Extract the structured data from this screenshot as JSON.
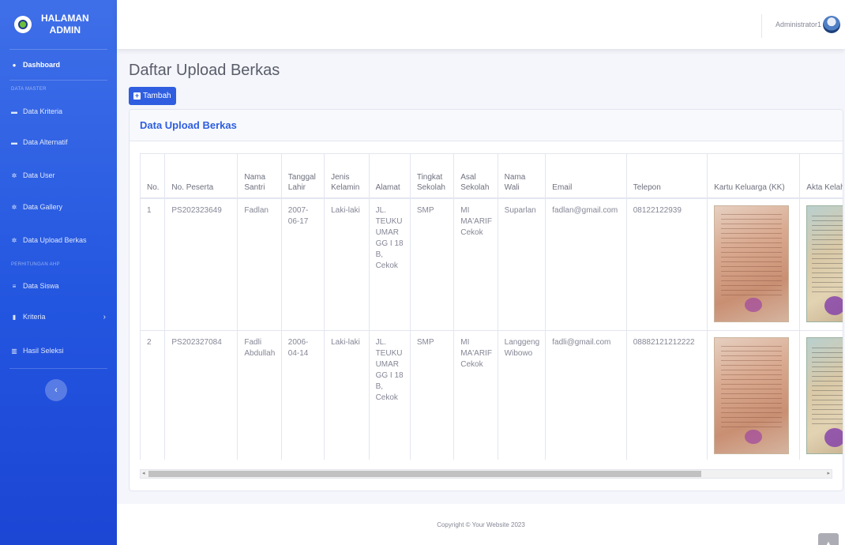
{
  "sidebar": {
    "brand_line1": "HALAMAN",
    "brand_line2": "ADMIN",
    "items": [
      {
        "label": "Dashboard",
        "icon": "tachometer-icon"
      },
      {
        "heading": "DATA MASTER"
      },
      {
        "label": "Data Kriteria",
        "icon": "folder-icon"
      },
      {
        "label": "Data Alternatif",
        "icon": "folder-icon"
      },
      {
        "label": "Data User",
        "icon": "gear-icon"
      },
      {
        "label": "Data Gallery",
        "icon": "gear-icon"
      },
      {
        "label": "Data Upload Berkas",
        "icon": "gear-icon"
      },
      {
        "heading": "PERHITUNGAN AHP"
      },
      {
        "label": "Data Siswa",
        "icon": "list-icon"
      },
      {
        "label": "Kriteria",
        "icon": "document-icon"
      },
      {
        "label": "Hasil Seleksi",
        "icon": "chart-icon"
      }
    ],
    "toggle_icon": "chevron-left-icon"
  },
  "topbar": {
    "user_name": "Administrator1"
  },
  "main": {
    "page_title": "Daftar Upload Berkas",
    "add_button": "Tambah",
    "card_title": "Data Upload Berkas",
    "table": {
      "headers": [
        "No.",
        "No. Peserta",
        "Nama Santri",
        "Tanggal Lahir",
        "Jenis Kelamin",
        "Alamat",
        "Tingkat Sekolah",
        "Asal Sekolah",
        "Nama Wali",
        "Email",
        "Telepon",
        "Kartu Keluarga (KK)",
        "Akta Kelahiran"
      ],
      "rows": [
        {
          "no": "1",
          "peserta": "PS202323649",
          "nama": "Fadlan",
          "tgl": "2007-06-17",
          "jk": "Laki-laki",
          "alamat": "JL. TEUKU UMAR GG I 18 B, Cekok",
          "tingkat": "SMP",
          "asal": "MI MA'ARIF Cekok",
          "wali": "Suparlan",
          "email": "fadlan@gmail.com",
          "telp": "08122122939"
        },
        {
          "no": "2",
          "peserta": "PS202327084",
          "nama": "Fadli Abdullah",
          "tgl": "2006-04-14",
          "jk": "Laki-laki",
          "alamat": "JL. TEUKU UMAR GG I 18 B, Cekok",
          "tingkat": "SMP",
          "asal": "MI MA'ARIF Cekok",
          "wali": "Langgeng Wibowo",
          "email": "fadli@gmail.com",
          "telp": "08882121212222"
        }
      ]
    }
  },
  "footer": {
    "copyright": "Copyright © Your Website 2023"
  },
  "colors": {
    "sidebar": "#2356e0",
    "primary": "#2f5ee0",
    "background": "#f4f6fc"
  }
}
